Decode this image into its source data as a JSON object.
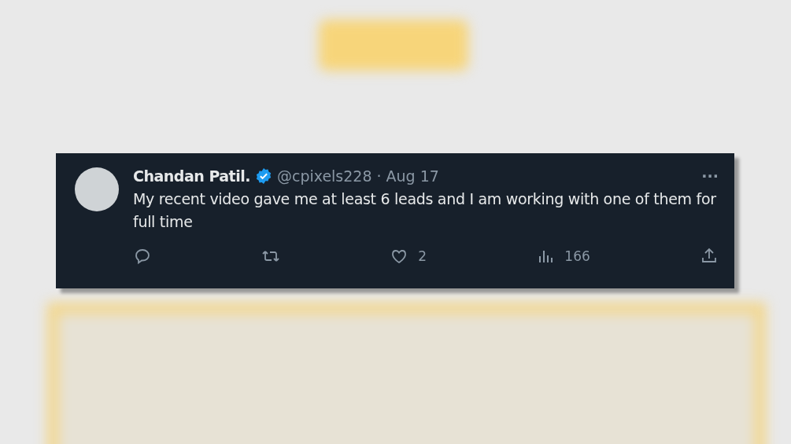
{
  "tweet": {
    "author": "Chandan Patil.",
    "verified": true,
    "handle": "@cpixels228",
    "separator": "·",
    "date": "Aug 17",
    "text": "My recent video gave me at least 6 leads and I am working with one of them for full time",
    "more": "···",
    "actions": [
      {
        "kind": "reply"
      },
      {
        "kind": "repost"
      },
      {
        "kind": "like",
        "count": "2"
      },
      {
        "kind": "views",
        "count": "166"
      },
      {
        "kind": "share"
      }
    ]
  }
}
